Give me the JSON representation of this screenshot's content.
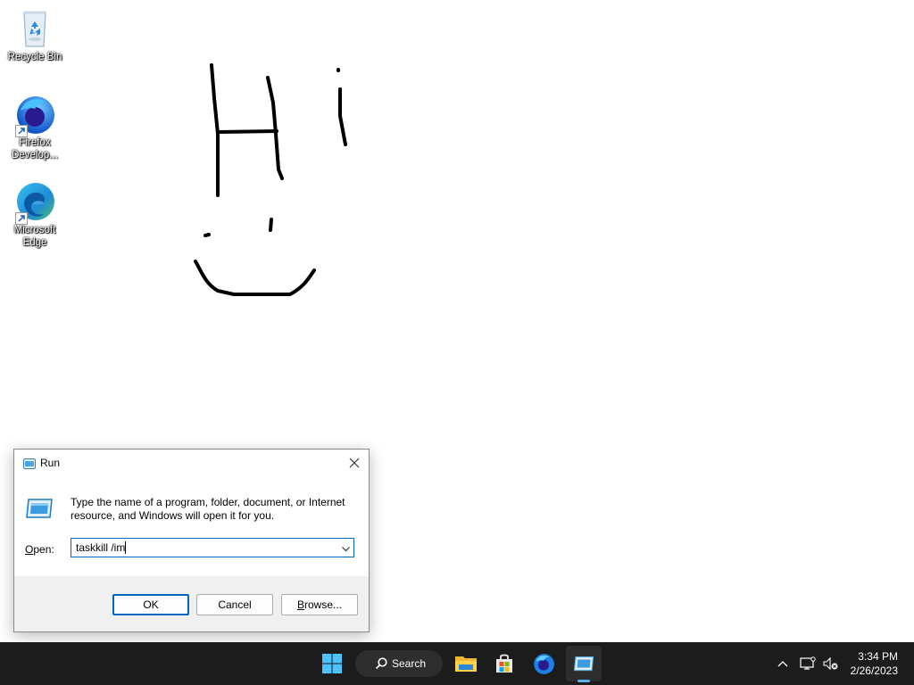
{
  "desktop": {
    "icons": [
      {
        "label": "Recycle Bin",
        "icon": "recycle-bin-icon"
      },
      {
        "label": "Firefox Develop...",
        "icon": "firefox-developer-icon"
      },
      {
        "label": "Microsoft Edge",
        "icon": "microsoft-edge-icon"
      }
    ],
    "drawing": "hand-drawn-doodle"
  },
  "run_dialog": {
    "title": "Run",
    "description": "Type the name of a program, folder, document, or Internet resource, and Windows will open it for you.",
    "open_label": "Open:",
    "open_value": "taskkill /im",
    "buttons": {
      "ok": "OK",
      "cancel": "Cancel",
      "browse": "Browse..."
    }
  },
  "taskbar": {
    "search_label": "Search",
    "apps": [
      "start-icon",
      "file-explorer-icon",
      "microsoft-store-icon",
      "firefox-developer-icon",
      "run-icon"
    ],
    "active_app": "run-icon",
    "accent": "#5ab0e8"
  },
  "system_tray": {
    "time": "3:34 PM",
    "date": "2/26/2023"
  }
}
